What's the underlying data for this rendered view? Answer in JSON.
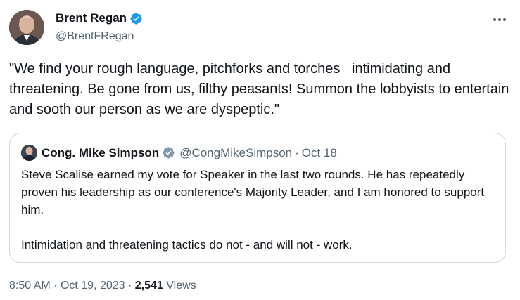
{
  "author": {
    "display_name": "Brent Regan",
    "handle": "@BrentFRegan",
    "verified_color": "#1d9bf0"
  },
  "tweet": {
    "text": "\"We find your rough language, pitchforks and torches   intimidating and threatening. Be gone from us, filthy peasants! Summon the lobbyists to entertain and sooth our person as we are dyspeptic.\""
  },
  "quoted_tweet": {
    "display_name": "Cong. Mike Simpson",
    "handle": "@CongMikeSimpson",
    "separator": "·",
    "date": "Oct 18",
    "verified_color": "#829aab",
    "text": "Steve Scalise earned my vote for Speaker in the last two rounds. He has repeatedly proven his leadership as our conference's Majority Leader, and I am honored to support him.\n\nIntimidation and threatening tactics do not - and will not - work."
  },
  "meta": {
    "time": "8:50 AM",
    "separator": "·",
    "date": "Oct 19, 2023",
    "views_count": "2,541",
    "views_label": "Views"
  },
  "icons": {
    "more": "more-horizontal-icon",
    "verified": "verified-badge-icon"
  }
}
